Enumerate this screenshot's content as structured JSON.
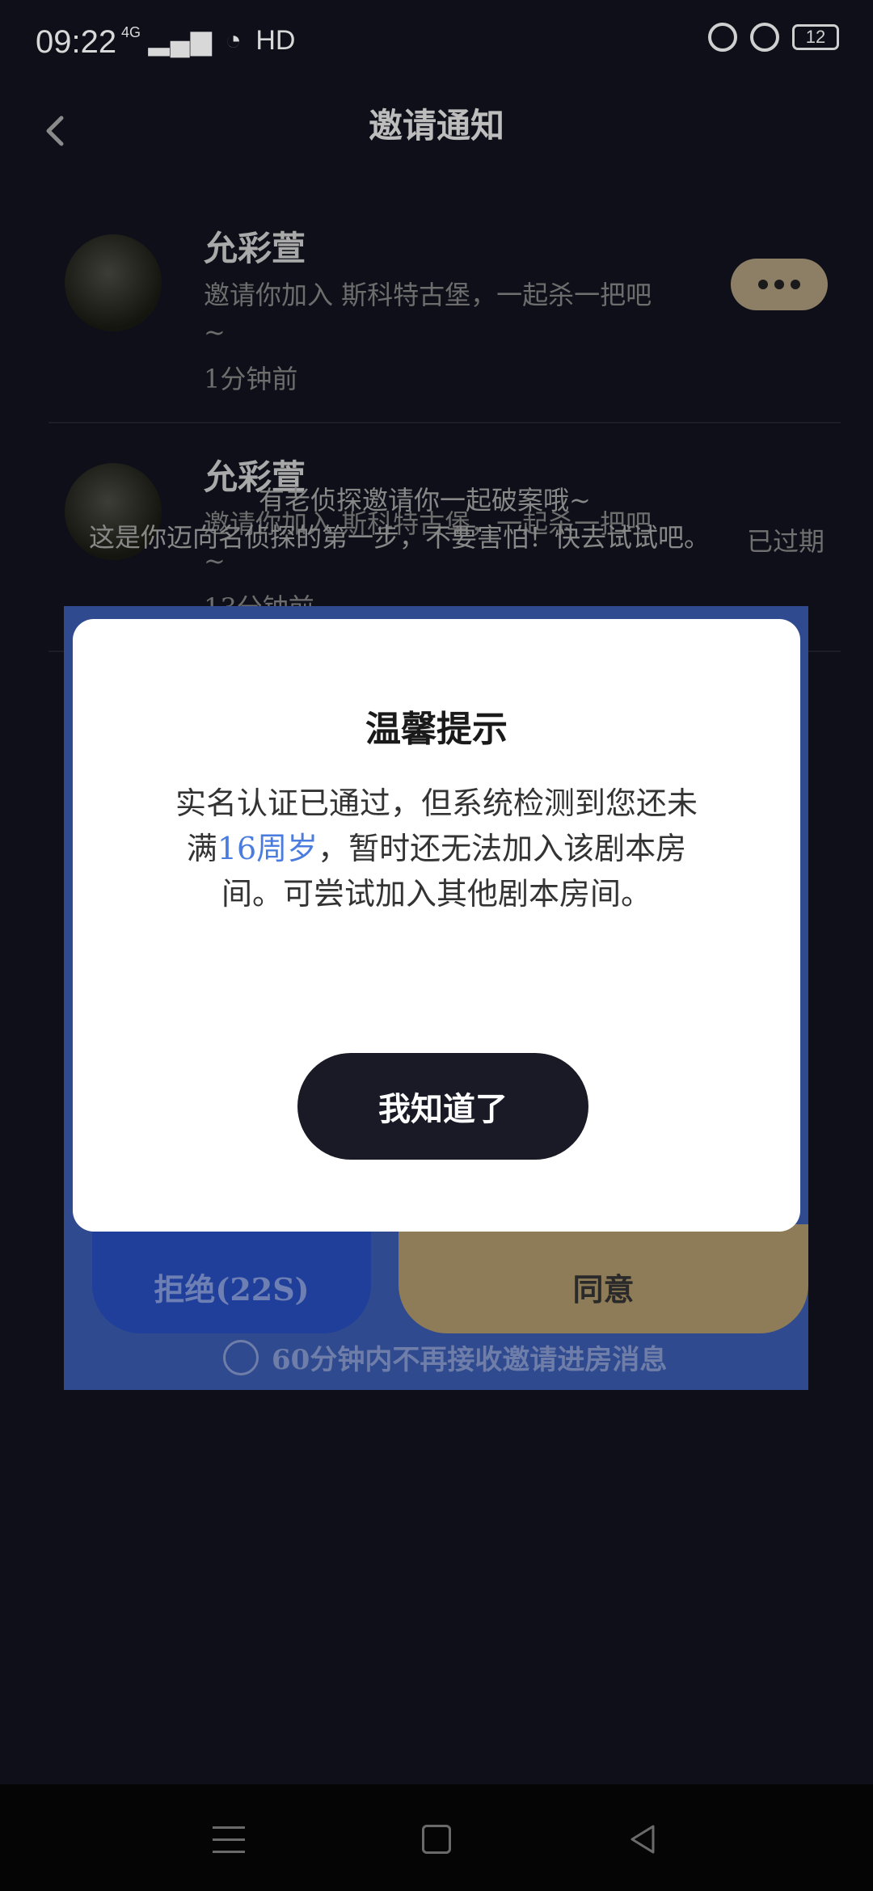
{
  "status_bar": {
    "time": "09:22",
    "signal": "4G",
    "network": "HD",
    "battery": "12"
  },
  "header": {
    "title": "邀请通知"
  },
  "invitations": [
    {
      "name": "允彩萱",
      "message": "邀请你加入 斯科特古堡，一起杀一把吧~",
      "time": "1分钟前"
    },
    {
      "name": "允彩萱",
      "message": "邀请你加入 斯科特古堡，一起杀一把吧~",
      "time": "13分钟前",
      "status": "已过期"
    }
  ],
  "overlay": {
    "line1": "有老侦探邀请你一起破案哦~",
    "line2": "这是你迈向名侦探的第一步，不要害怕！快去试试吧。"
  },
  "panel": {
    "reject_label": "拒绝(22S)",
    "agree_label": "同意",
    "mute_label": "60分钟内不再接收邀请进房消息"
  },
  "modal": {
    "title": "温馨提示",
    "body_part1": "实名认证已通过，但系统检测到您还未满",
    "body_highlight": "16周岁",
    "body_part2": "，暂时还无法加入该剧本房间。可尝试加入其他剧本房间。",
    "button_label": "我知道了"
  },
  "colors": {
    "accent": "#4a7ce0",
    "gold": "#8e7b57",
    "blue": "#1f3f9a"
  }
}
